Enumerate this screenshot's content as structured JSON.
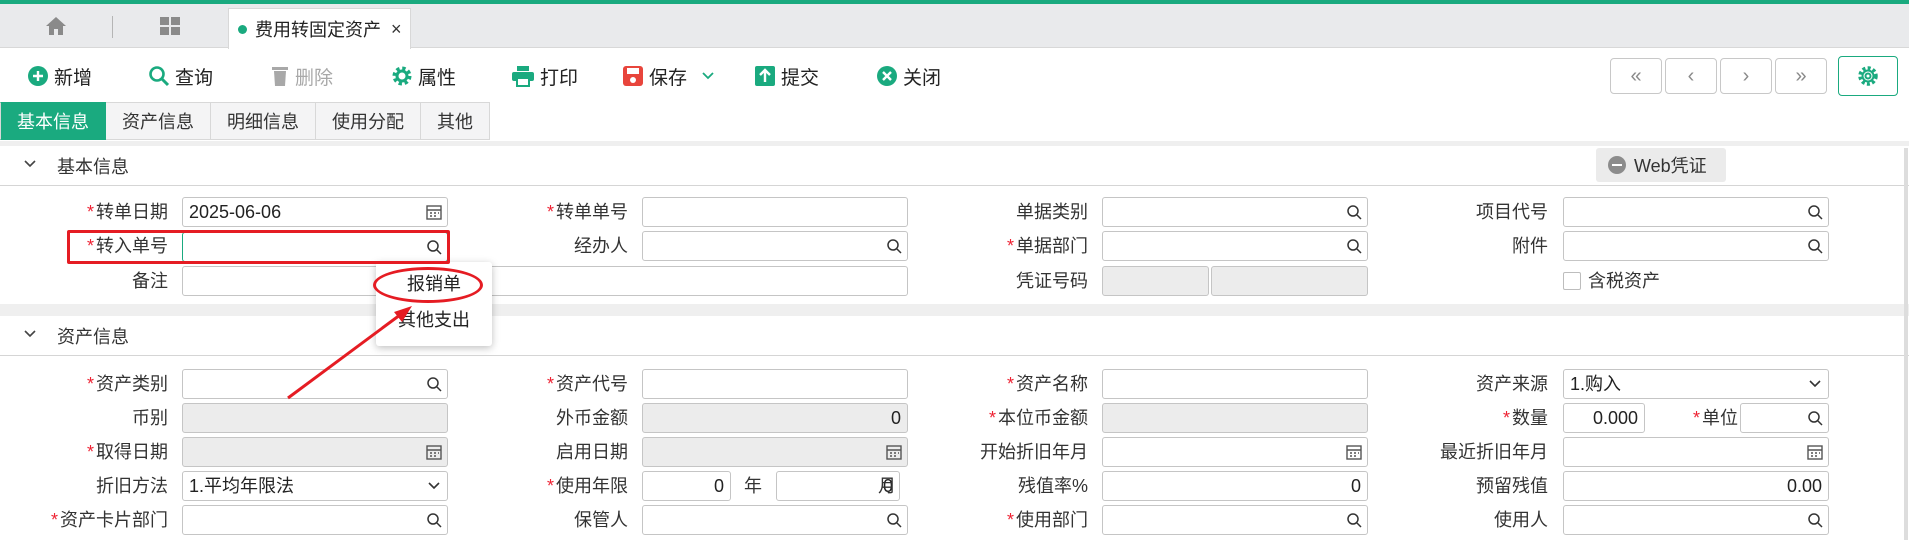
{
  "tabbar": {
    "home_icon": "home-icon",
    "grid_icon": "grid-icon",
    "tab_title": "费用转固定资产",
    "close": "×"
  },
  "toolbar": {
    "new": "新增",
    "query": "查询",
    "delete": "删除",
    "props": "属性",
    "print": "打印",
    "save": "保存",
    "submit": "提交",
    "close": "关闭",
    "nav_first": "«",
    "nav_prev": "‹",
    "nav_next": "›",
    "nav_last": "»"
  },
  "tabs": [
    "基本信息",
    "资产信息",
    "明细信息",
    "使用分配",
    "其他"
  ],
  "sections": {
    "basic": "基本信息",
    "asset": "资产信息"
  },
  "web_voucher": "Web凭证",
  "basic": {
    "date_label": "转单日期",
    "date_value": "2025-06-06",
    "doc_no_label": "转单单号",
    "bill_type_label": "单据类别",
    "project_label": "项目代号",
    "in_no_label": "转入单号",
    "handler_label": "经办人",
    "dept_label": "单据部门",
    "attach_label": "附件",
    "remark_label": "备注",
    "voucher_label": "凭证号码",
    "tax_label": "含税资产"
  },
  "popup": {
    "item1": "报销单",
    "item2": "其他支出"
  },
  "asset": {
    "category_label": "资产类别",
    "code_label": "资产代号",
    "name_label": "资产名称",
    "source_label": "资产来源",
    "source_value": "1.购入",
    "currency_label": "币别",
    "foreign_label": "外币金额",
    "foreign_value": "0",
    "local_label": "本位币金额",
    "qty_label": "数量",
    "qty_value": "0.000",
    "unit_label": "单位",
    "acq_label": "取得日期",
    "start_label": "启用日期",
    "dep_start_label": "开始折旧年月",
    "last_dep_label": "最近折旧年月",
    "method_label": "折旧方法",
    "method_value": "1.平均年限法",
    "life_label": "使用年限",
    "life_year": "0",
    "year_unit": "年",
    "life_month": "0",
    "month_unit": "月",
    "residual_label": "残值率%",
    "residual_value": "0",
    "reserve_label": "预留残值",
    "reserve_value": "0.00",
    "card_dept_label": "资产卡片部门",
    "keeper_label": "保管人",
    "use_dept_label": "使用部门",
    "user_label": "使用人"
  }
}
